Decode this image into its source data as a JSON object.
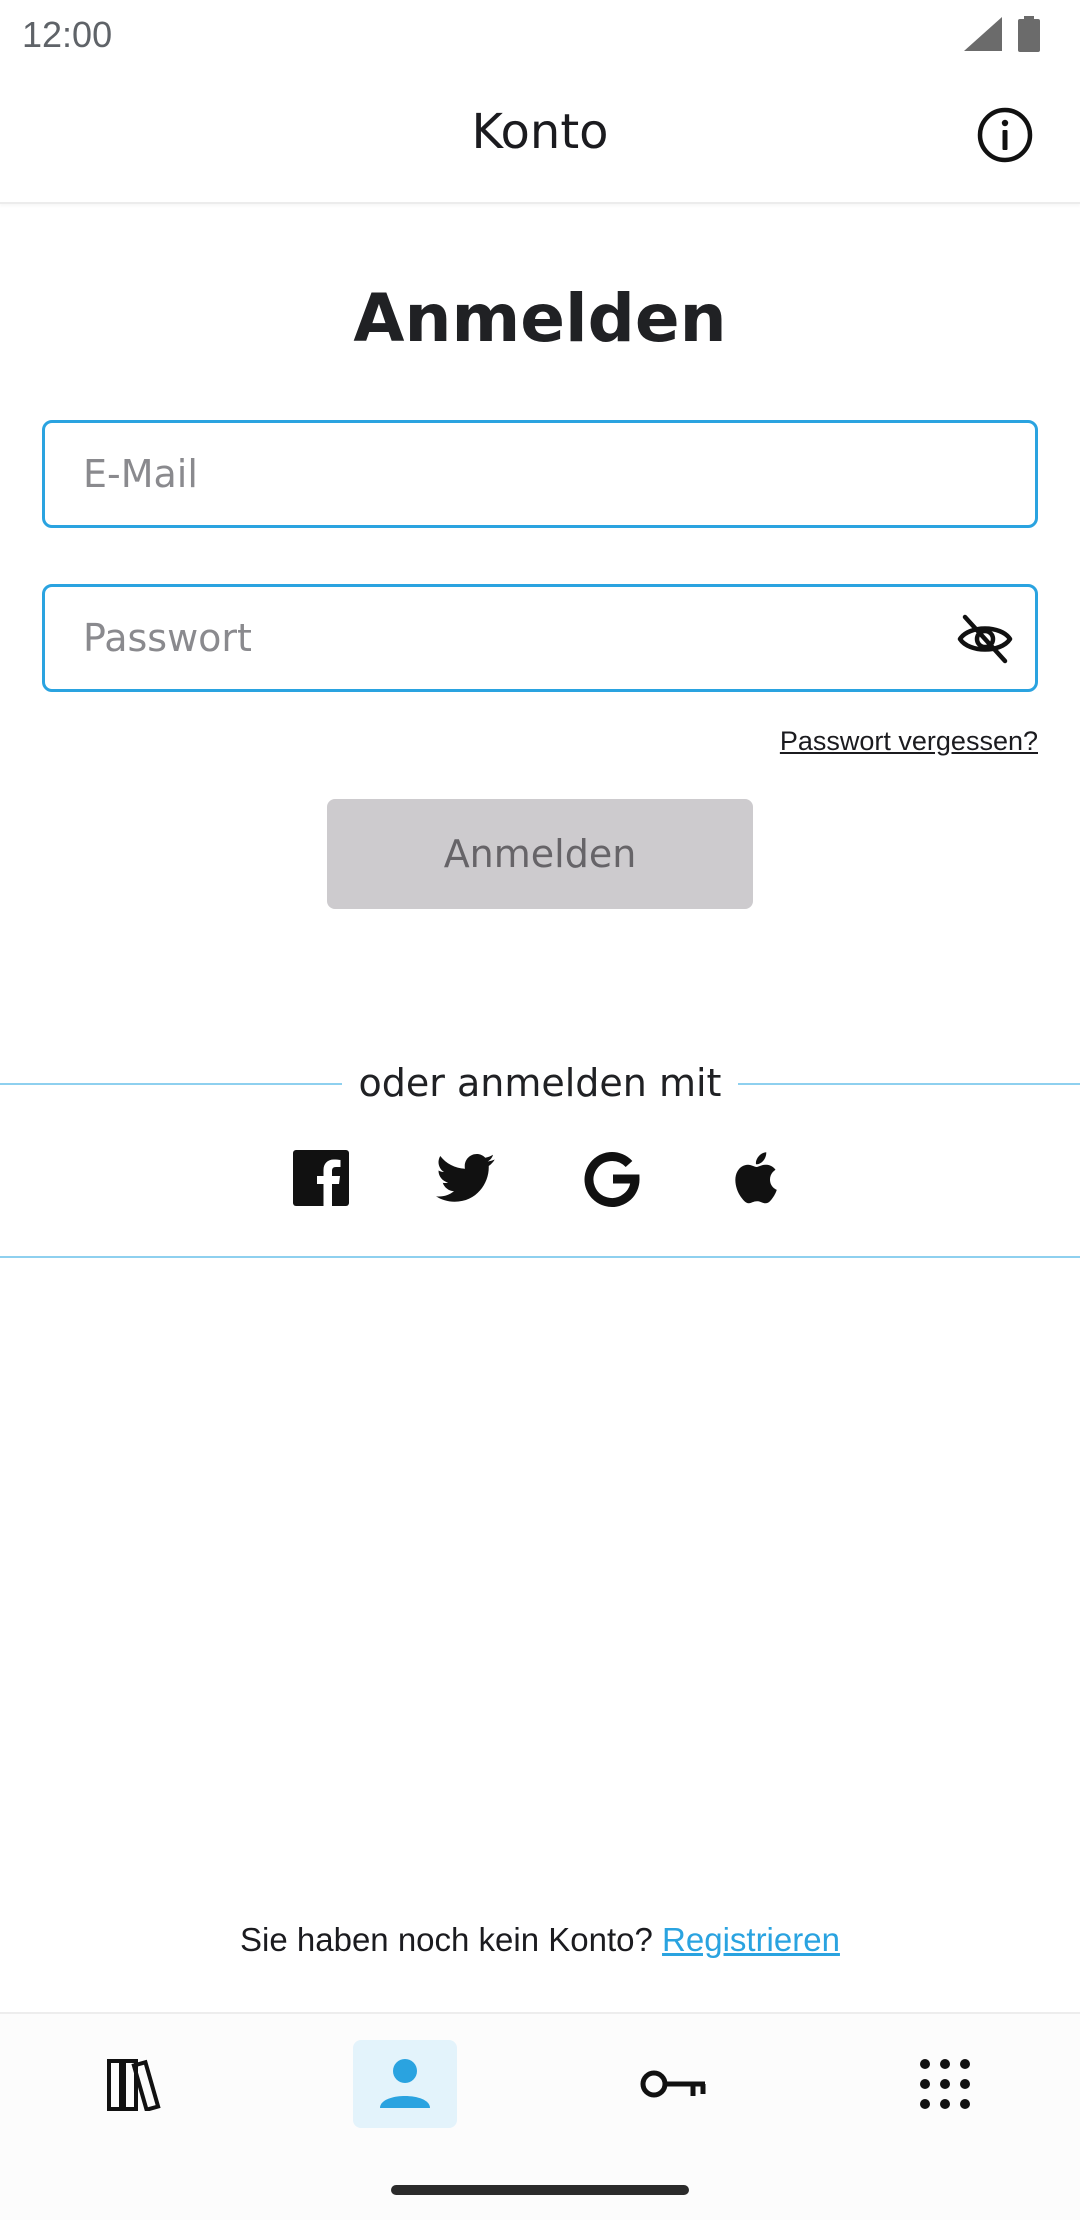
{
  "status_bar": {
    "time": "12:00"
  },
  "app_bar": {
    "title": "Konto"
  },
  "login": {
    "heading": "Anmelden",
    "email_placeholder": "E-Mail",
    "password_placeholder": "Passwort",
    "forgot_password": "Passwort vergessen?",
    "submit_label": "Anmelden"
  },
  "social": {
    "divider_text": "oder anmelden mit",
    "providers": [
      "facebook-icon",
      "twitter-icon",
      "google-icon",
      "apple-icon"
    ]
  },
  "register": {
    "prompt": "Sie haben noch kein Konto?",
    "link": "Registrieren"
  },
  "bottom_nav": {
    "items": [
      "library-icon",
      "account-icon",
      "key-icon",
      "apps-grid-icon"
    ],
    "active": "account-icon"
  },
  "colors": {
    "accent": "#2aa3e0",
    "disabled_button": "#cdcbce",
    "active_nav_bg": "#e3f3fb"
  }
}
